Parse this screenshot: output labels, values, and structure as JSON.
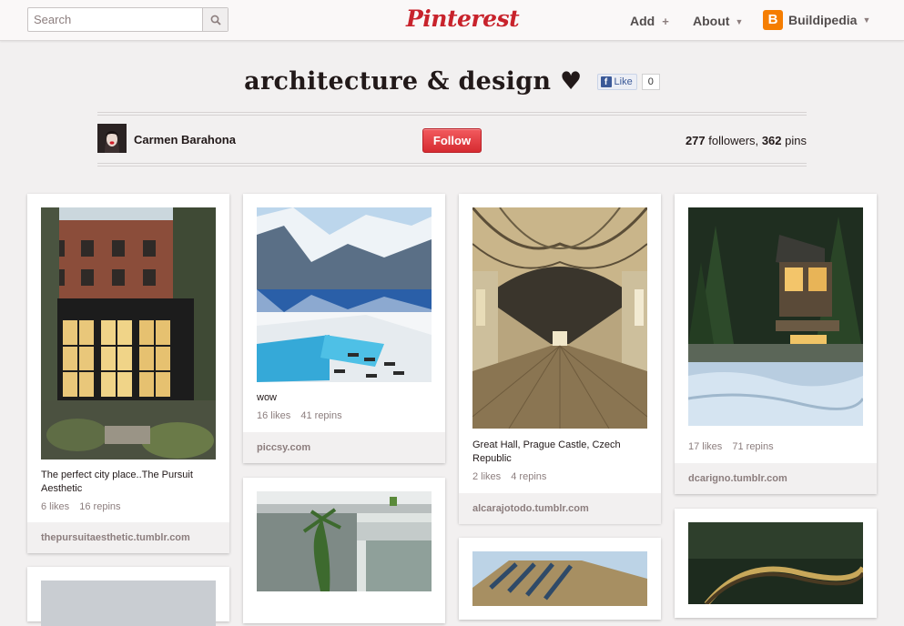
{
  "header": {
    "search": {
      "placeholder": "Search"
    },
    "logo": "Pinterest",
    "nav": {
      "add": "Add",
      "about": "About",
      "user": "Buildipedia"
    }
  },
  "board": {
    "title": "architecture & design ♥",
    "fb_like_label": "Like",
    "fb_like_count": "0",
    "owner_name": "Carmen Barahona",
    "follow_label": "Follow",
    "followers_count": "277",
    "followers_label": "followers,",
    "pins_count": "362",
    "pins_label": "pins"
  },
  "pins": [
    {
      "description": "The perfect city place..The Pursuit Aesthetic",
      "likes": "6 likes",
      "repins": "16 repins",
      "source": "thepursuitaesthetic.tumblr.com"
    },
    {
      "description": "wow",
      "likes": "16 likes",
      "repins": "41 repins",
      "source": "piccsy.com"
    },
    {
      "description": "Great Hall, Prague Castle, Czech Republic",
      "likes": "2 likes",
      "repins": "4 repins",
      "source": "alcarajotodo.tumblr.com"
    },
    {
      "description": "",
      "likes": "17 likes",
      "repins": "71 repins",
      "source": "dcarigno.tumblr.com"
    }
  ],
  "colors": {
    "brand_red": "#c8232c",
    "follow_red": "#d62b31",
    "facebook_blue": "#3b5998",
    "blogger_orange": "#f57d00"
  }
}
